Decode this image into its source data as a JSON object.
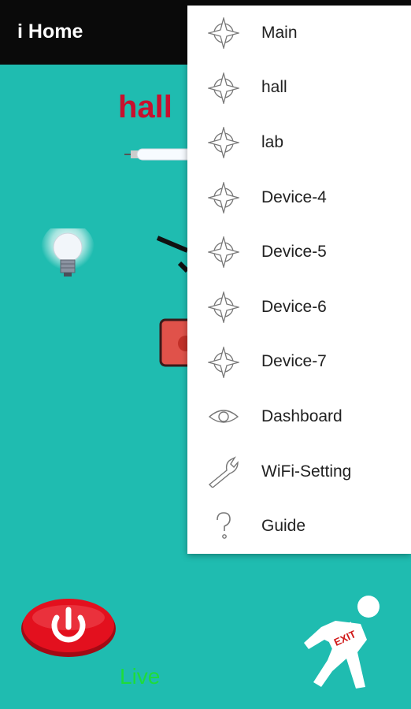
{
  "appbar": {
    "title": "i Home"
  },
  "room": {
    "title": "hall"
  },
  "status": {
    "live": "Live"
  },
  "menu": {
    "items": [
      {
        "label": "Main",
        "icon": "compass-star-icon"
      },
      {
        "label": "hall",
        "icon": "compass-star-icon"
      },
      {
        "label": "lab",
        "icon": "compass-star-icon"
      },
      {
        "label": "Device-4",
        "icon": "compass-star-icon"
      },
      {
        "label": "Device-5",
        "icon": "compass-star-icon"
      },
      {
        "label": "Device-6",
        "icon": "compass-star-icon"
      },
      {
        "label": "Device-7",
        "icon": "compass-star-icon"
      },
      {
        "label": "Dashboard",
        "icon": "eye-icon"
      },
      {
        "label": "WiFi-Setting",
        "icon": "wrench-icon"
      },
      {
        "label": "Guide",
        "icon": "question-icon"
      }
    ]
  },
  "colors": {
    "background": "#1fbcb0",
    "appbar": "#0a0a0a",
    "room_title": "#c8102e",
    "live": "#1edc3a",
    "power_button": "#e3101e"
  }
}
